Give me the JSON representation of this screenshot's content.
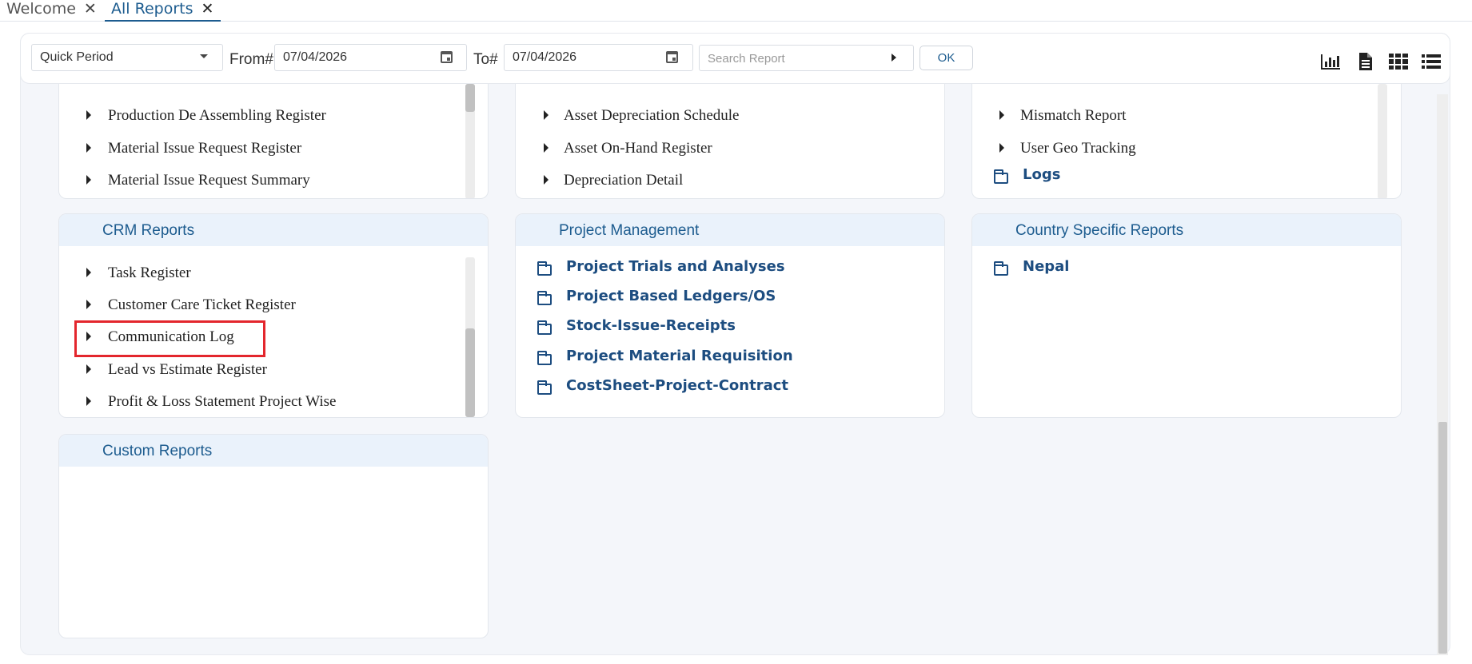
{
  "tabs": [
    {
      "label": "Welcome",
      "active": false
    },
    {
      "label": "All Reports",
      "active": true
    }
  ],
  "toolbar": {
    "quick_period": "Quick Period",
    "from_label": "From#",
    "from_value": "07/04/2026",
    "to_label": "To#",
    "to_value": "07/04/2026",
    "search_placeholder": "Search Report",
    "ok_label": "OK",
    "view_icons": [
      "bar-chart-icon",
      "document-icon",
      "grid-icon",
      "list-icon"
    ]
  },
  "panels": {
    "left_top": {
      "items": [
        "Production De Assembling Register",
        "Material Issue Request Register",
        "Material Issue Request Summary"
      ]
    },
    "mid_top": {
      "items": [
        "Asset Depreciation Schedule",
        "Asset On-Hand Register",
        "Depreciation Detail"
      ]
    },
    "right_top": {
      "items": [
        "Mismatch Report",
        "User Geo Tracking"
      ],
      "folders": [
        "Logs"
      ]
    },
    "crm": {
      "title": "CRM Reports",
      "items": [
        "Task Register",
        "Customer Care Ticket Register",
        "Communication Log",
        "Lead vs Estimate Register",
        "Profit & Loss Statement Project Wise"
      ]
    },
    "project": {
      "title": "Project Management",
      "folders": [
        "Project Trials and Analyses",
        "Project Based Ledgers/OS",
        "Stock-Issue-Receipts",
        "Project Material Requisition",
        "CostSheet-Project-Contract"
      ]
    },
    "country": {
      "title": "Country Specific Reports",
      "folders": [
        "Nepal"
      ]
    },
    "custom": {
      "title": "Custom Reports"
    }
  },
  "colors": {
    "accent": "#1d5c8f",
    "folder": "#1d4d80",
    "panel_header": "#eaf2fb",
    "highlight": "#e3262d"
  }
}
